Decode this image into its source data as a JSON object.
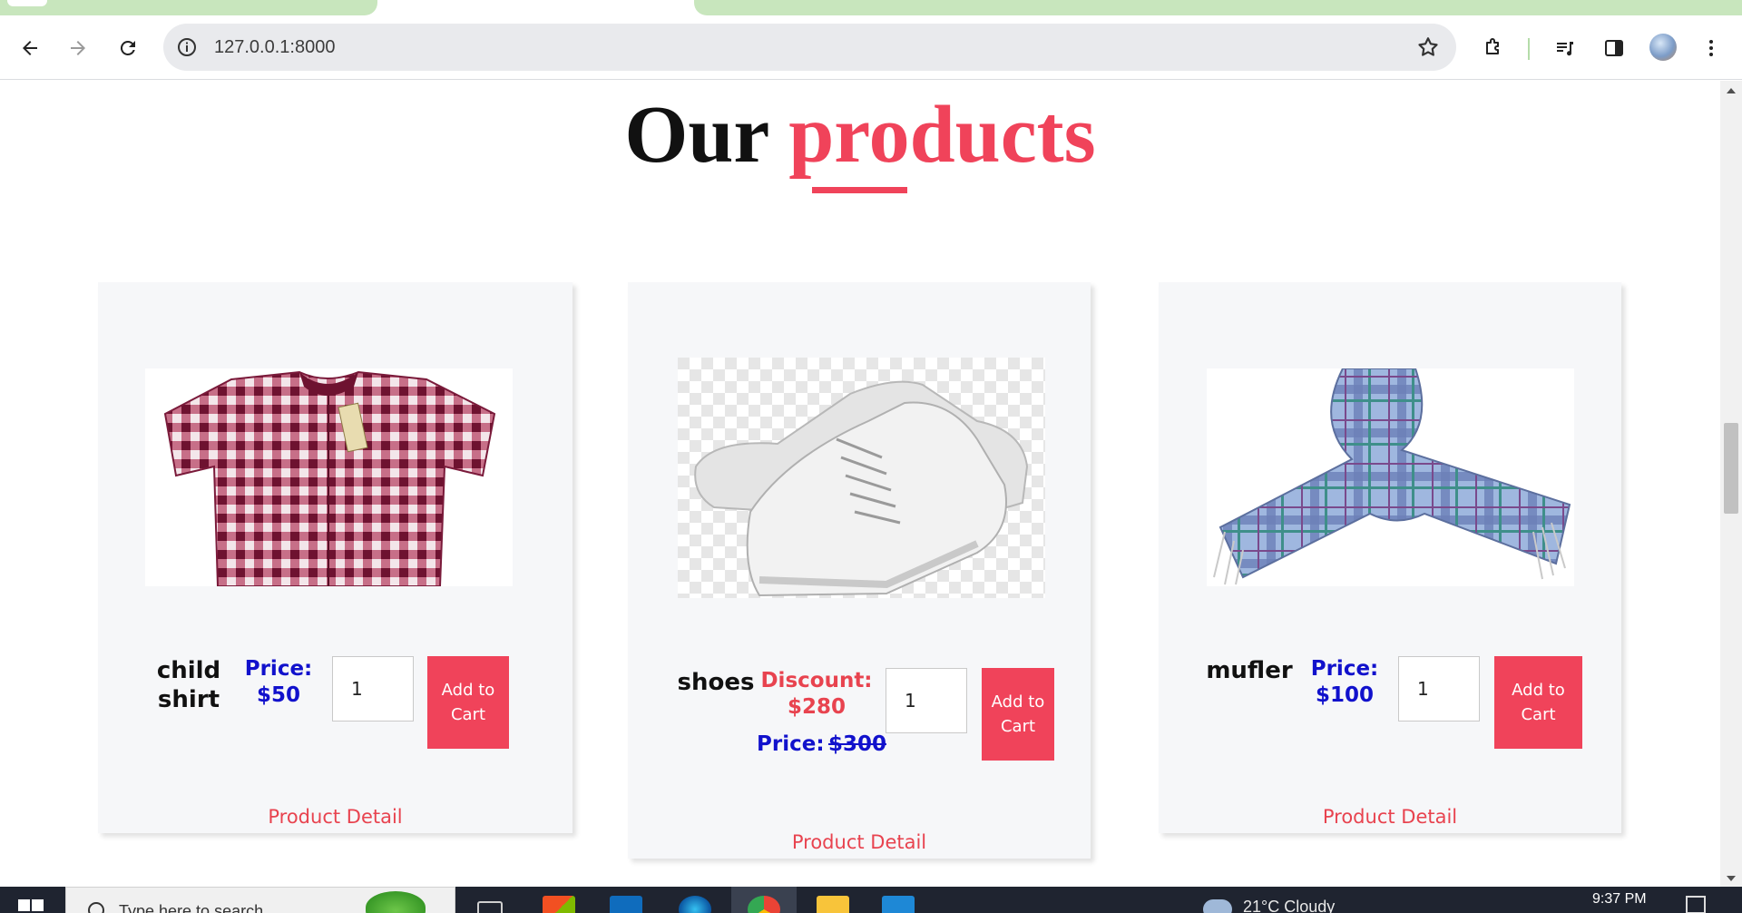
{
  "browser": {
    "url": "127.0.0.1:8000"
  },
  "page": {
    "heading_dark": "Our",
    "heading_accent": "products",
    "accent_color": "#f0435a"
  },
  "products": [
    {
      "name": "child shirt",
      "price_label": "Price:",
      "price": "$50",
      "quantity": "1",
      "add_label": "Add to Cart",
      "detail_label": "Product Detail",
      "image": "plaid-shirt-image"
    },
    {
      "name": "shoes",
      "discount_label": "Discount:",
      "discount_price": "$280",
      "price_label": "Price:",
      "price": "$300",
      "quantity": "1",
      "add_label": "Add to Cart",
      "detail_label": "Product Detail",
      "image": "white-sneakers-image"
    },
    {
      "name": "mufler",
      "price_label": "Price:",
      "price": "$100",
      "quantity": "1",
      "add_label": "Add to Cart",
      "detail_label": "Product Detail",
      "image": "plaid-scarf-image"
    }
  ],
  "taskbar": {
    "search_placeholder": "Type here to search",
    "weather": "21°C  Cloudy",
    "time": "9:37 PM"
  }
}
